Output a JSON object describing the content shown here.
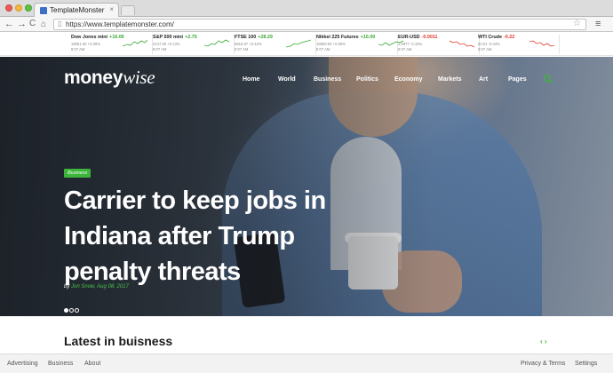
{
  "browser": {
    "tab_title": "TemplateMonster",
    "tab_close": "×",
    "url": "https://www.templatemonster.com/",
    "back_glyph": "←",
    "forward_glyph": "→",
    "reload_glyph": "C",
    "home_glyph": "⌂",
    "star_glyph": "☆",
    "menu_glyph": "≡"
  },
  "ticker": [
    {
      "name": "Dow Jones mini",
      "change": "+16.00",
      "direction": "up",
      "line": "18051.00  +0.09%",
      "time": "8:07 AM"
    },
    {
      "name": "S&P 500 mini",
      "change": "+2.75",
      "direction": "up",
      "line": "2147.00  +0.13%",
      "time": "8:07 AM"
    },
    {
      "name": "FTSE 100",
      "change": "+28.29",
      "direction": "up",
      "line": "6815.97  +0.42%",
      "time": "8:07 AM"
    },
    {
      "name": "Nikkei 225 Futures",
      "change": "+10.00",
      "direction": "up",
      "line": "16900.00  +0.06%",
      "time": "8:07 AM"
    },
    {
      "name": "EUR-USD",
      "change": "-0.0011",
      "direction": "down",
      "line": "1.0977  -0.10%",
      "time": "8:07 AM"
    },
    {
      "name": "WTI Crude",
      "change": "-0.22",
      "direction": "down",
      "line": "50.01  -0.44%",
      "time": "8:07 AM"
    }
  ],
  "site": {
    "logo_bold": "money",
    "logo_italic": "wise",
    "nav": [
      "Home",
      "World",
      "Business",
      "Politics",
      "Economy",
      "Markets",
      "Art",
      "Pages"
    ]
  },
  "hero": {
    "category": "Business",
    "headline": "Carrier to keep jobs in Indiana after Trump penalty threats",
    "byline_prefix": "by",
    "byline_author_date": "Jon Snow, Aug 08, 2017"
  },
  "section": {
    "title": "Latest in buisness",
    "arrows": "‹ ›"
  },
  "footer": {
    "left": [
      "Advertising",
      "Business",
      "About"
    ],
    "right": [
      "Privacy & Terms",
      "Settings"
    ]
  },
  "colors": {
    "accent_green": "#3db53b",
    "ticker_up": "#38a832",
    "ticker_down": "#e0382c"
  }
}
